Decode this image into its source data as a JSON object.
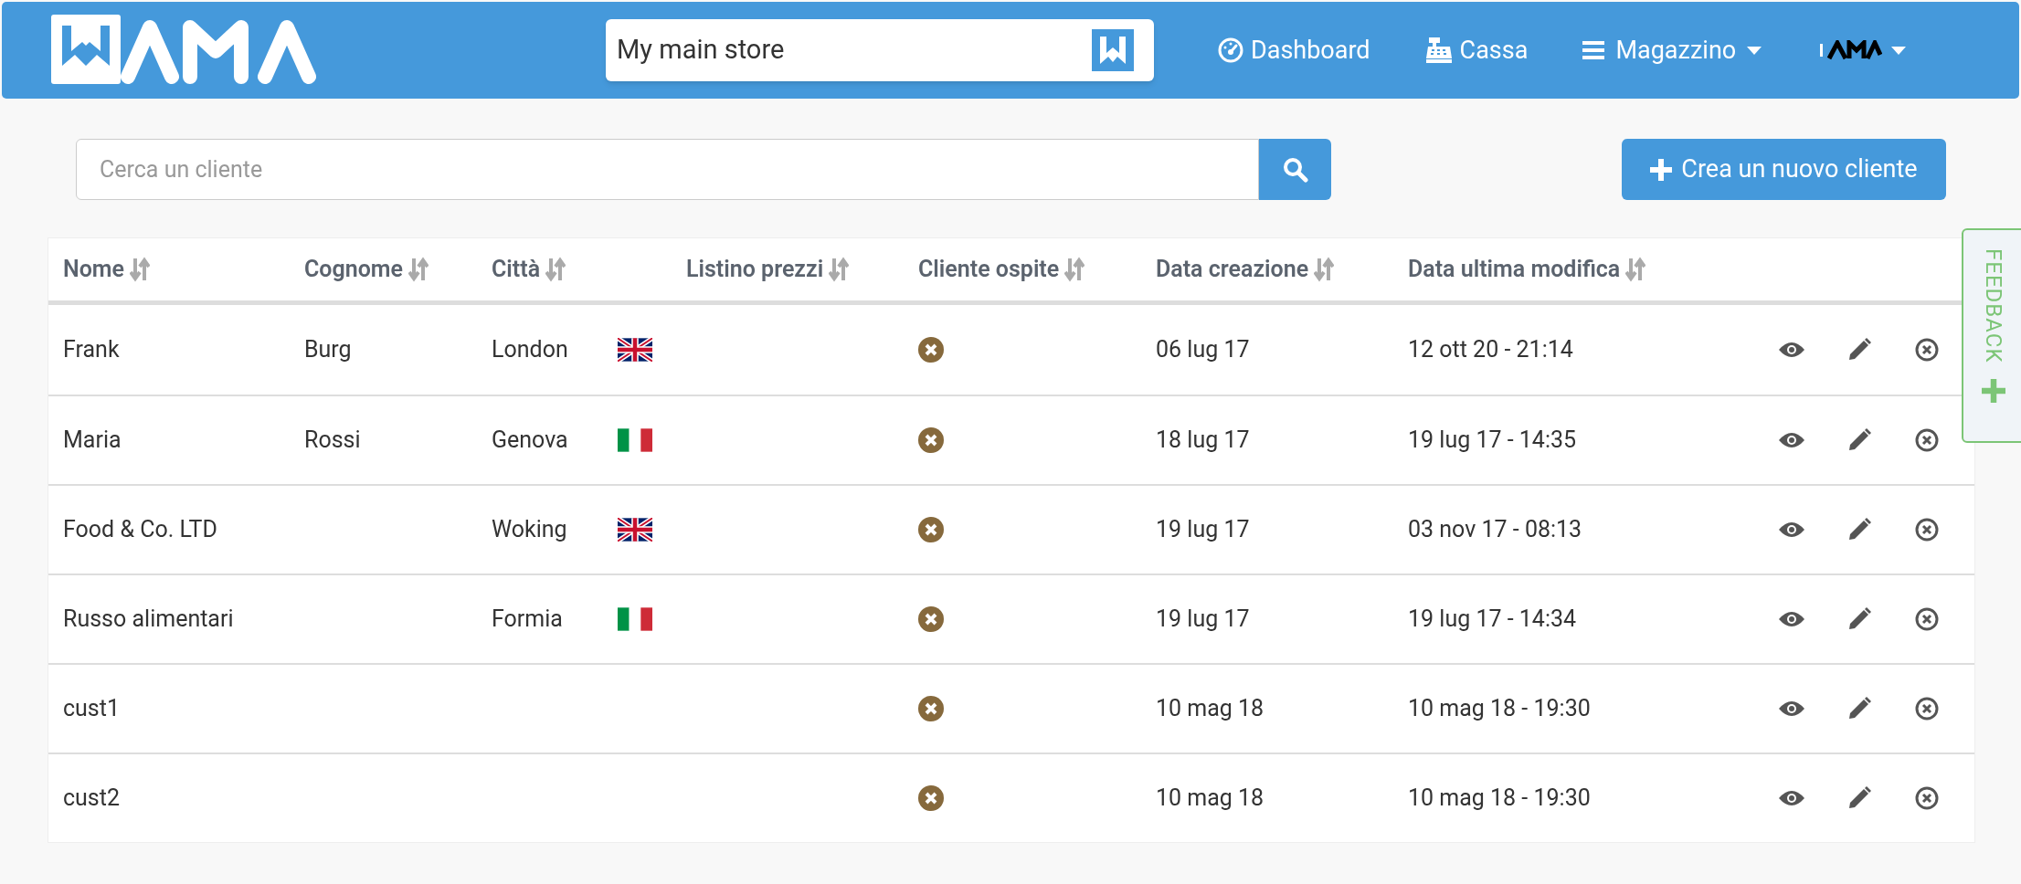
{
  "header": {
    "store_selector": {
      "value": "My main store"
    },
    "nav": [
      {
        "kind": "dashboard",
        "label": "Dashboard",
        "dropdown": false
      },
      {
        "kind": "register",
        "label": "Cassa",
        "dropdown": false
      },
      {
        "kind": "menu",
        "label": "Magazzino",
        "dropdown": true
      }
    ]
  },
  "search": {
    "placeholder": "Cerca un cliente"
  },
  "create_button": {
    "label": "Crea un nuovo cliente"
  },
  "table": {
    "columns": [
      "Nome",
      "Cognome",
      "Città",
      "Listino prezzi",
      "Cliente ospite",
      "Data creazione",
      "Data ultima modifica"
    ],
    "rows": [
      {
        "nome": "Frank",
        "cognome": "Burg",
        "citta": "London",
        "kind": "uk_flag",
        "guest": false,
        "created": "06 lug 17",
        "modified": "12 ott 20 - 21:14"
      },
      {
        "nome": "Maria",
        "cognome": "Rossi",
        "citta": "Genova",
        "kind": "it_flag",
        "guest": false,
        "created": "18 lug 17",
        "modified": "19 lug 17 - 14:35"
      },
      {
        "nome": "Food & Co. LTD",
        "cognome": "",
        "citta": "Woking",
        "kind": "uk_flag",
        "guest": false,
        "created": "19 lug 17",
        "modified": "03 nov 17 - 08:13"
      },
      {
        "nome": "Russo alimentari",
        "cognome": "",
        "citta": "Formia",
        "kind": "it_flag",
        "guest": false,
        "created": "19 lug 17",
        "modified": "19 lug 17 - 14:34"
      },
      {
        "nome": "cust1",
        "cognome": "",
        "citta": "",
        "kind": "plain",
        "guest": false,
        "created": "10 mag 18",
        "modified": "10 mag 18 - 19:30"
      },
      {
        "nome": "cust2",
        "cognome": "",
        "citta": "",
        "kind": "plain",
        "guest": false,
        "created": "10 mag 18",
        "modified": "10 mag 18 - 19:30"
      }
    ]
  },
  "feedback_tab": {
    "label": "FEEDBACK"
  }
}
